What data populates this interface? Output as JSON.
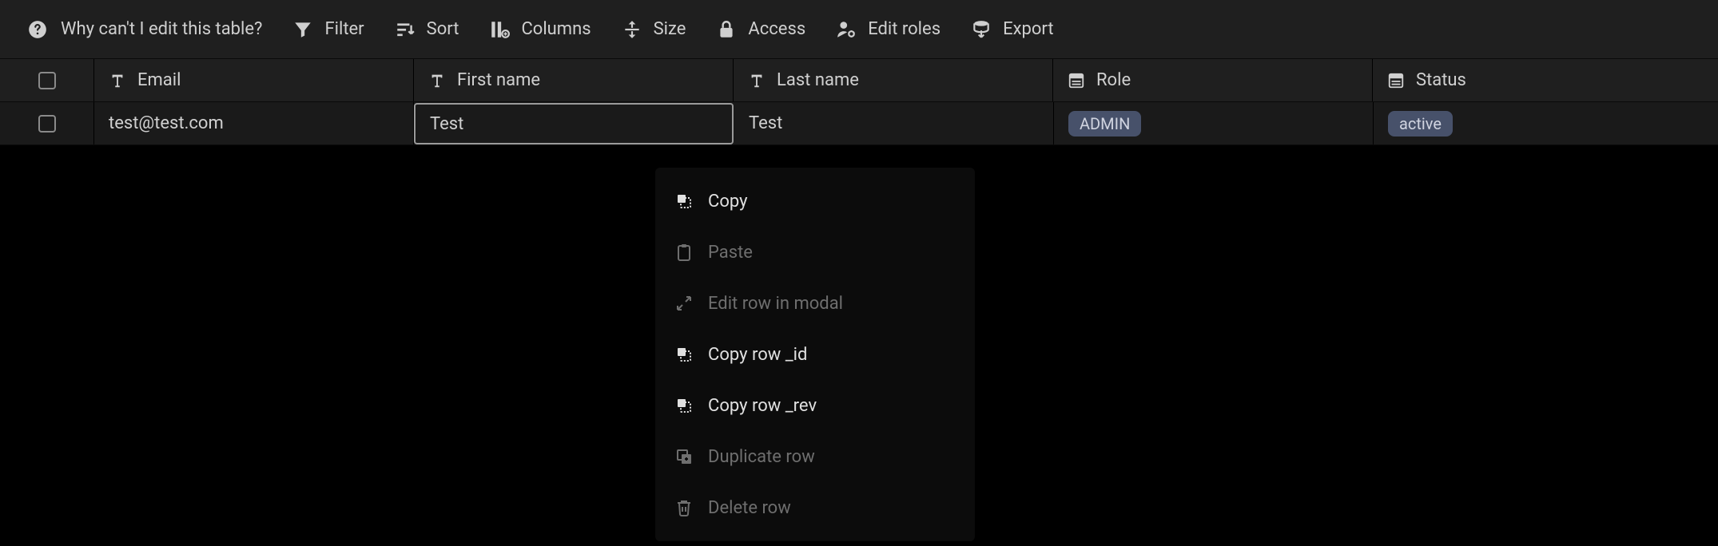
{
  "toolbar": {
    "hint": "Why can't I edit this table?",
    "filter": "Filter",
    "sort": "Sort",
    "columns": "Columns",
    "size": "Size",
    "access": "Access",
    "edit_roles": "Edit roles",
    "export": "Export"
  },
  "headers": {
    "email": "Email",
    "first_name": "First name",
    "last_name": "Last name",
    "role": "Role",
    "status": "Status"
  },
  "rows": [
    {
      "email": "test@test.com",
      "first_name": "Test",
      "last_name": "Test",
      "role": "ADMIN",
      "status": "active"
    }
  ],
  "context_menu": {
    "copy": "Copy",
    "paste": "Paste",
    "edit_modal": "Edit row in modal",
    "copy_id": "Copy row _id",
    "copy_rev": "Copy row _rev",
    "duplicate": "Duplicate row",
    "delete": "Delete row"
  }
}
